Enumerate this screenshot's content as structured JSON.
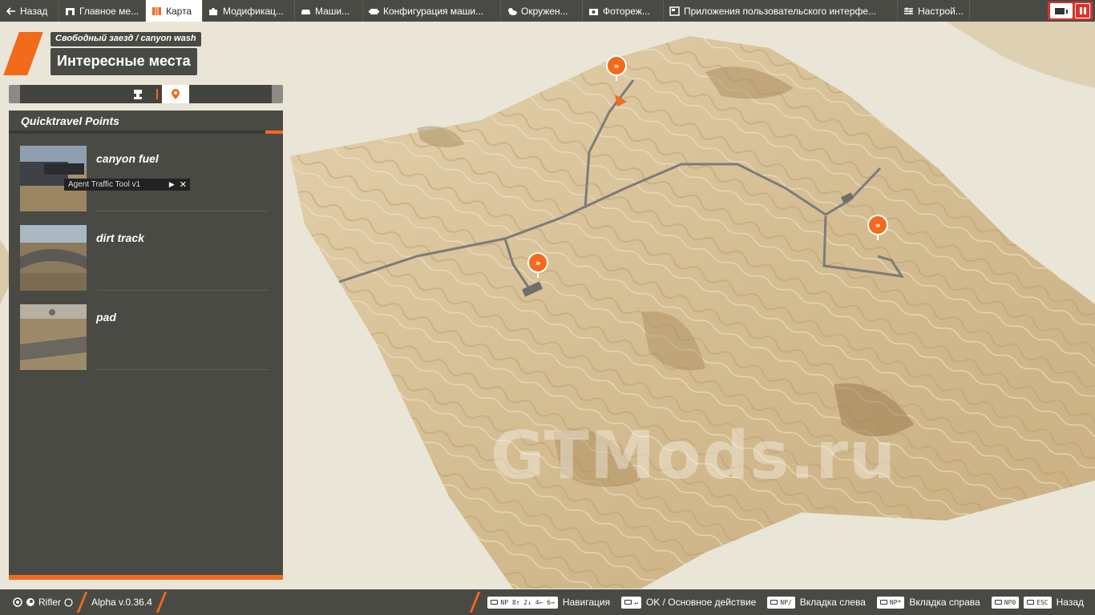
{
  "topbar": {
    "back_label": "Назад",
    "tabs": [
      {
        "label": "Главное ме...",
        "icon": "home-icon"
      },
      {
        "label": "Карта",
        "icon": "map-icon",
        "active": true
      },
      {
        "label": "Модификац...",
        "icon": "puzzle-icon"
      },
      {
        "label": "Маши...",
        "icon": "car-icon"
      },
      {
        "label": "Конфигурация маши...",
        "icon": "engine-icon"
      },
      {
        "label": "Окружен...",
        "icon": "weather-icon"
      },
      {
        "label": "Фотореж...",
        "icon": "camera-icon"
      },
      {
        "label": "Приложения пользовательского интерфе...",
        "icon": "ui-apps-icon"
      },
      {
        "label": "Настрой...",
        "icon": "sliders-icon"
      }
    ]
  },
  "header": {
    "breadcrumb": "Свободный заезд / canyon wash",
    "title": "Интересные места"
  },
  "panel": {
    "heading": "Quicktravel Points",
    "items": [
      {
        "name": "canyon fuel"
      },
      {
        "name": "dirt track"
      },
      {
        "name": "pad"
      }
    ],
    "tooltip": "Agent Traffic Tool v1"
  },
  "watermark": "GTMods.ru",
  "bottombar": {
    "user": "Rifler",
    "version": "Alpha v.0.36.4",
    "hints": [
      {
        "key": "NP 8↑ 2↓ 4← 6→",
        "label": "Навигация"
      },
      {
        "key": "↵",
        "label": "OK / Основное действие"
      },
      {
        "key": "NP/",
        "label": "Вкладка слева"
      },
      {
        "key": "NP*",
        "label": "Вкладка справа"
      },
      {
        "key": "NP0",
        "label": ""
      },
      {
        "key": "ESC",
        "label": "Назад"
      }
    ]
  },
  "colors": {
    "accent": "#f26a1b",
    "panel": "#4a4a45",
    "terrain": "#d9c6a0"
  }
}
